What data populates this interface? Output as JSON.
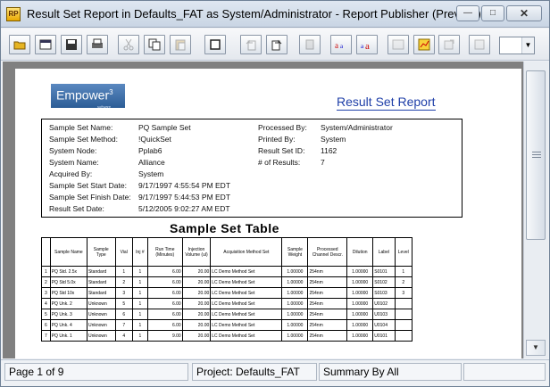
{
  "window": {
    "title": "Result Set Report in Defaults_FAT as System/Administrator - Report Publisher (Preview)",
    "app_icon": "report-publisher-icon",
    "minimize": "—",
    "maximize": "□",
    "close": "✕"
  },
  "toolbar": {
    "buttons": [
      {
        "icon": "open-folder-icon",
        "enabled": true
      },
      {
        "icon": "window-icon",
        "enabled": true
      },
      {
        "icon": "save-icon",
        "enabled": true
      },
      {
        "icon": "print-icon",
        "enabled": true
      },
      {
        "icon": "cut-icon",
        "enabled": false
      },
      {
        "icon": "copy-icon",
        "enabled": true
      },
      {
        "icon": "paste-icon",
        "enabled": false
      },
      {
        "icon": "frame-icon",
        "enabled": true
      },
      {
        "icon": "undo-icon",
        "enabled": false
      },
      {
        "icon": "redo-icon",
        "enabled": true
      },
      {
        "icon": "lock-icon",
        "enabled": false
      },
      {
        "icon": "font-smaller-icon",
        "enabled": true
      },
      {
        "icon": "font-larger-icon",
        "enabled": true
      },
      {
        "icon": "image-icon",
        "enabled": false
      },
      {
        "icon": "chart-icon",
        "enabled": true
      },
      {
        "icon": "export-icon",
        "enabled": false
      },
      {
        "icon": "settings-icon",
        "enabled": false
      }
    ],
    "zoom_value": ""
  },
  "report": {
    "logo_text": "Empower",
    "logo_sup": "3",
    "logo_sub": "software",
    "title": "Result Set Report",
    "info_labels": [
      "Sample Set Name:",
      "Sample Set Method:",
      "System Node:",
      "System Name:",
      "Acquired By:",
      "Sample Set Start Date:",
      "Sample Set Finish Date:",
      "Result Set Date:"
    ],
    "info_values": [
      "PQ Sample Set",
      "!QuickSet",
      "Pplab6",
      "Alliance",
      "System",
      "9/17/1997 4:55:54 PM EDT",
      "9/17/1997 5:44:53 PM EDT",
      "5/12/2005 9:02:27 AM EDT"
    ],
    "info2_labels": [
      "Processed By:",
      "Printed By:",
      "Result Set ID:",
      "# of Results:"
    ],
    "info2_values": [
      "System/Administrator",
      "System",
      "1162",
      "7"
    ],
    "table_title": "Sample Set Table",
    "table_headers": [
      "",
      "Sample Name",
      "Sample Type",
      "Vial",
      "Inj #",
      "Run Time (Minutes)",
      "Injection Volume (ul)",
      "Acquisition Method Set",
      "Sample Weight",
      "Processed Channel Descr.",
      "Dilution",
      "Label",
      "Level"
    ],
    "table_rows": [
      [
        "1",
        "PQ Std. 2.5x",
        "Standard",
        "1",
        "1",
        "6.00",
        "20.00",
        "LC Demo Method Set",
        "1.00000",
        "254nm",
        "1.00000",
        "S0101",
        "1"
      ],
      [
        "2",
        "PQ Std 5.0x",
        "Standard",
        "2",
        "1",
        "6.00",
        "20.00",
        "LC Demo Method Set",
        "1.00000",
        "254nm",
        "1.00000",
        "S0102",
        "2"
      ],
      [
        "3",
        "PQ Std 10x",
        "Standard",
        "3",
        "1",
        "6.00",
        "20.00",
        "LC Demo Method Set",
        "1.00000",
        "254nm",
        "1.00000",
        "S0103",
        "3"
      ],
      [
        "4",
        "PQ Unk. 2",
        "Unknown",
        "5",
        "1",
        "6.00",
        "20.00",
        "LC Demo Method Set",
        "1.00000",
        "254nm",
        "1.00000",
        "U0102",
        ""
      ],
      [
        "5",
        "PQ Unk. 3",
        "Unknown",
        "6",
        "1",
        "6.00",
        "20.00",
        "LC Demo Method Set",
        "1.00000",
        "254nm",
        "1.00000",
        "U0103",
        ""
      ],
      [
        "6",
        "PQ Unk. 4",
        "Unknown",
        "7",
        "1",
        "6.00",
        "20.00",
        "LC Demo Method Set",
        "1.00000",
        "254nm",
        "1.00000",
        "U0104",
        ""
      ],
      [
        "7",
        "PQ Unk. 1",
        "Unknown",
        "4",
        "1",
        "9.00",
        "20.00",
        "LC Demo Method Set",
        "1.00000",
        "254nm",
        "1.00000",
        "U0101",
        ""
      ]
    ]
  },
  "status": {
    "page": "Page 1 of 9",
    "project": "Project: Defaults_FAT",
    "summary": "Summary By All"
  },
  "scrollbar": {
    "up": "▲",
    "down": "▼",
    "thumb_top_fraction": 0.0
  }
}
